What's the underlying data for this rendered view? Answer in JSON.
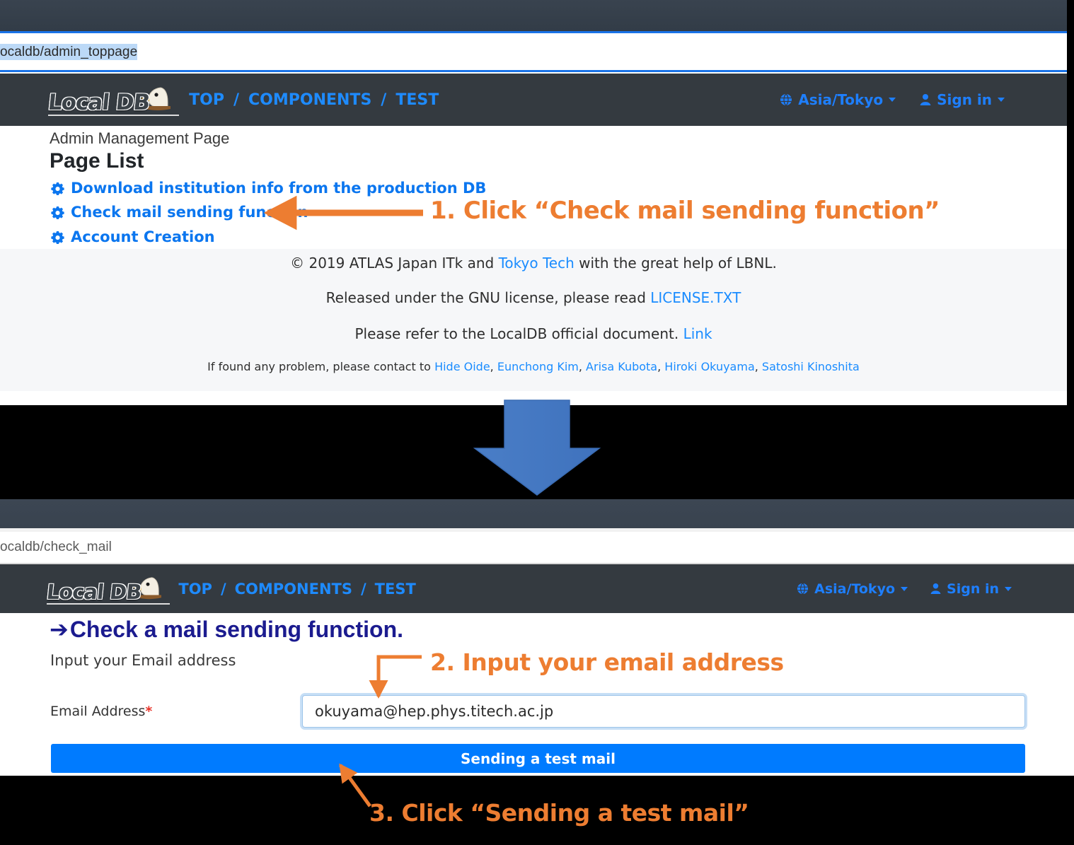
{
  "browser_top": {
    "url": "ocaldb/admin_toppage",
    "url_selected": true
  },
  "browser_bottom": {
    "url": "ocaldb/check_mail",
    "url_selected": false
  },
  "navbar": {
    "brand": "Local DB",
    "brand_icon": "eagle-mascot-icon",
    "links": [
      "TOP",
      "COMPONENTS",
      "TEST"
    ],
    "separator": "/",
    "timezone": "Asia/Tokyo",
    "timezone_icon": "globe-icon",
    "signin": "Sign in",
    "signin_icon": "person-icon",
    "caret_icon": "caret-down-icon"
  },
  "admin_page": {
    "subtitle": "Admin Management Page",
    "title": "Page List",
    "links": [
      {
        "icon": "gear-icon",
        "label": "Download institution info from the production DB"
      },
      {
        "icon": "gear-icon",
        "label": "Check mail sending function"
      },
      {
        "icon": "gear-icon",
        "label": "Account Creation"
      }
    ]
  },
  "footer": {
    "line1_pre": "© 2019 ATLAS Japan ITk and ",
    "line1_link": "Tokyo Tech",
    "line1_post": " with the great help of LBNL.",
    "line2_pre": "Released under the GNU license, please read ",
    "line2_link": "LICENSE.TXT",
    "line3_pre": "Please refer to the LocalDB official document. ",
    "line3_link": "Link",
    "line4_pre": "If found any problem, please contact to ",
    "contacts": [
      "Hide Oide",
      "Eunchong Kim",
      "Arisa Kubota",
      "Hiroki Okuyama",
      "Satoshi Kinoshita"
    ]
  },
  "check_mail_page": {
    "heading_arrow": "➔",
    "heading": "Check a mail sending function.",
    "instruction": "Input your Email address",
    "field_label": "Email Address",
    "required_marker": "*",
    "email_value": "okuyama@hep.phys.titech.ac.jp",
    "email_placeholder": "Email Address",
    "submit_label": "Sending a test mail"
  },
  "annotations": {
    "step1": "1. Click “Check mail sending function”",
    "step2": "2. Input your email address",
    "step3": "3. Click “Sending a test mail”",
    "arrow_color": "#ed7d31",
    "transition_arrow_icon": "down-arrow-icon",
    "transition_arrow_color": "#4a7ec7"
  }
}
